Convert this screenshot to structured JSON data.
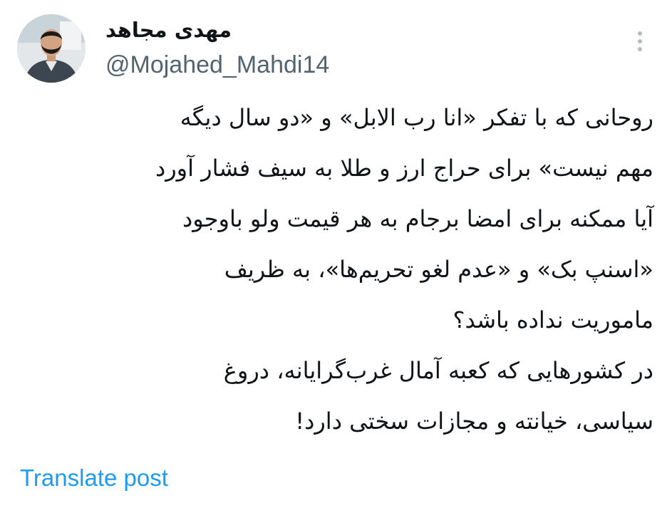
{
  "author": {
    "display_name": "مهدی مجاهد",
    "handle": "@Mojahed_Mahdi14",
    "avatar_icon": "user-avatar"
  },
  "post": {
    "lines": [
      "روحانی که با تفکر «انا رب الابل» و «دو سال دیگه",
      "مهم نیست» برای حراج ارز و طلا به سیف فشار آورد",
      "آیا ممکنه برای امضا برجام به هر قیمت ولو باوجود",
      "«اسنپ بک» و «عدم لغو تحریم‌ها»، به ظریف",
      "ماموریت نداده باشد؟",
      "در کشورهایی که کعبه آمال غرب‌گرایانه، دروغ",
      "سیاسی، خیانته و مجازات سختی دارد!"
    ],
    "translate_label": "Translate post"
  },
  "more_menu": {
    "icon": "more-vertical-icon"
  },
  "colors": {
    "text": "#0f1419",
    "secondary": "#536471",
    "link": "#1d9bf0"
  }
}
